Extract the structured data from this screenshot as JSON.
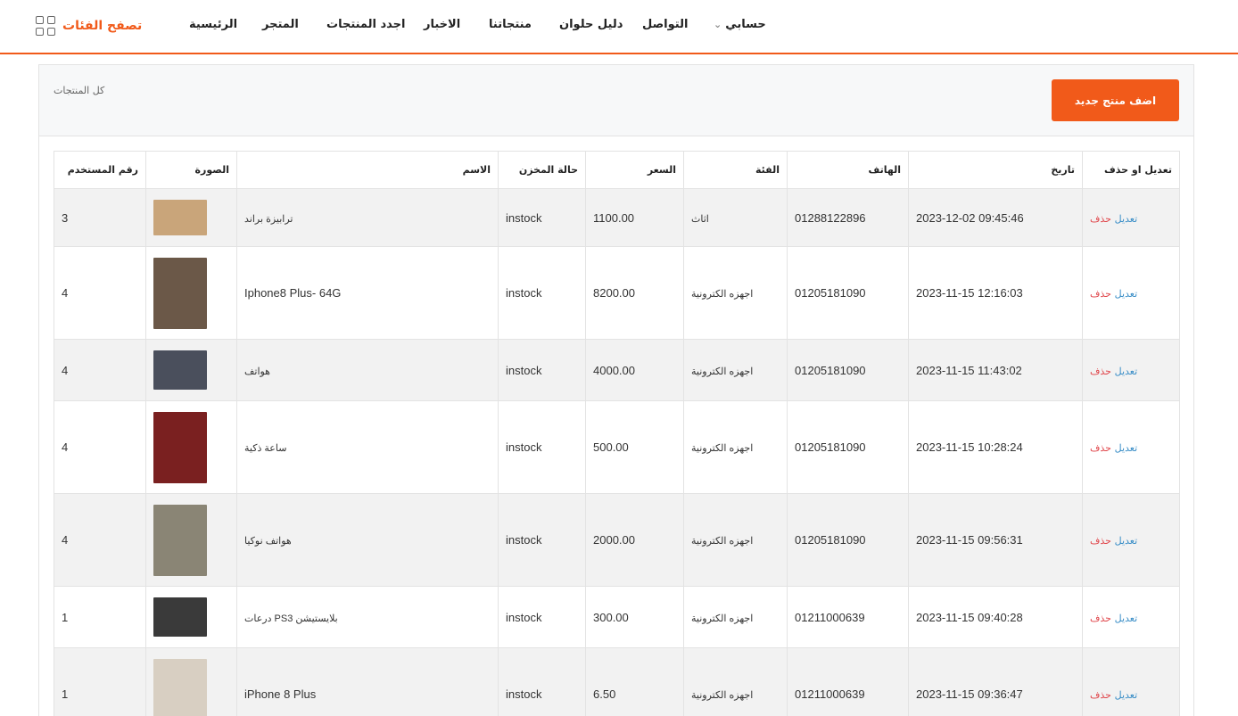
{
  "header": {
    "browse_categories": "تصفح الفئات",
    "nav": {
      "home": "الرئيسية",
      "store": "المتجر",
      "find_products": "اجدد المنتجات",
      "news": "الاخبار",
      "our_products": "منتجاتنا",
      "helwan_guide": "دليل حلوان",
      "contact": "التواصل",
      "my_account": "حسابي"
    }
  },
  "page": {
    "breadcrumb": "كل المنتجات",
    "add_button": "اضف منتج جديد"
  },
  "table": {
    "columns": {
      "user_id": "رقم المستخدم",
      "image": "الصورة",
      "name": "الاسم",
      "stock": "حالة المخزن",
      "price": "السعر",
      "category": "الفئة",
      "phone": "الهاتف",
      "date": "تاريخ",
      "actions": "تعديل او حذف"
    },
    "rows": [
      {
        "user_id": "3",
        "name": "ترابيزة براند",
        "stock": "instock",
        "price": "1100.00",
        "category": "اثاث",
        "phone": "01288122896",
        "date": "2023-12-02 09:45:46",
        "edit": "تعديل",
        "delete": "حذف",
        "thumb_color": "#c9a57a"
      },
      {
        "user_id": "4",
        "name": "Iphone8 Plus- 64G",
        "stock": "instock",
        "price": "8200.00",
        "category": "اجهزه الكترونية",
        "phone": "01205181090",
        "date": "2023-11-15 12:16:03",
        "edit": "تعديل",
        "delete": "حذف",
        "thumb_color": "#6b5848"
      },
      {
        "user_id": "4",
        "name": "هواتف",
        "stock": "instock",
        "price": "4000.00",
        "category": "اجهزه الكترونية",
        "phone": "01205181090",
        "date": "2023-11-15 11:43:02",
        "edit": "تعديل",
        "delete": "حذف",
        "thumb_color": "#4a4f5c"
      },
      {
        "user_id": "4",
        "name": "ساعة ذكية",
        "stock": "instock",
        "price": "500.00",
        "category": "اجهزه الكترونية",
        "phone": "01205181090",
        "date": "2023-11-15 10:28:24",
        "edit": "تعديل",
        "delete": "حذف",
        "thumb_color": "#7a2020"
      },
      {
        "user_id": "4",
        "name": "هواتف نوكيا",
        "stock": "instock",
        "price": "2000.00",
        "category": "اجهزه الكترونية",
        "phone": "01205181090",
        "date": "2023-11-15 09:56:31",
        "edit": "تعديل",
        "delete": "حذف",
        "thumb_color": "#8a8575"
      },
      {
        "user_id": "1",
        "name": "بلايستيشن PS3 درعات",
        "stock": "instock",
        "price": "300.00",
        "category": "اجهزه الكترونية",
        "phone": "01211000639",
        "date": "2023-11-15 09:40:28",
        "edit": "تعديل",
        "delete": "حذف",
        "thumb_color": "#3a3a3a"
      },
      {
        "user_id": "1",
        "name": "iPhone 8 Plus",
        "stock": "instock",
        "price": "6.50",
        "category": "اجهزه الكترونية",
        "phone": "01211000639",
        "date": "2023-11-15 09:36:47",
        "edit": "تعديل",
        "delete": "حذف",
        "thumb_color": "#d8cfc2"
      }
    ]
  }
}
